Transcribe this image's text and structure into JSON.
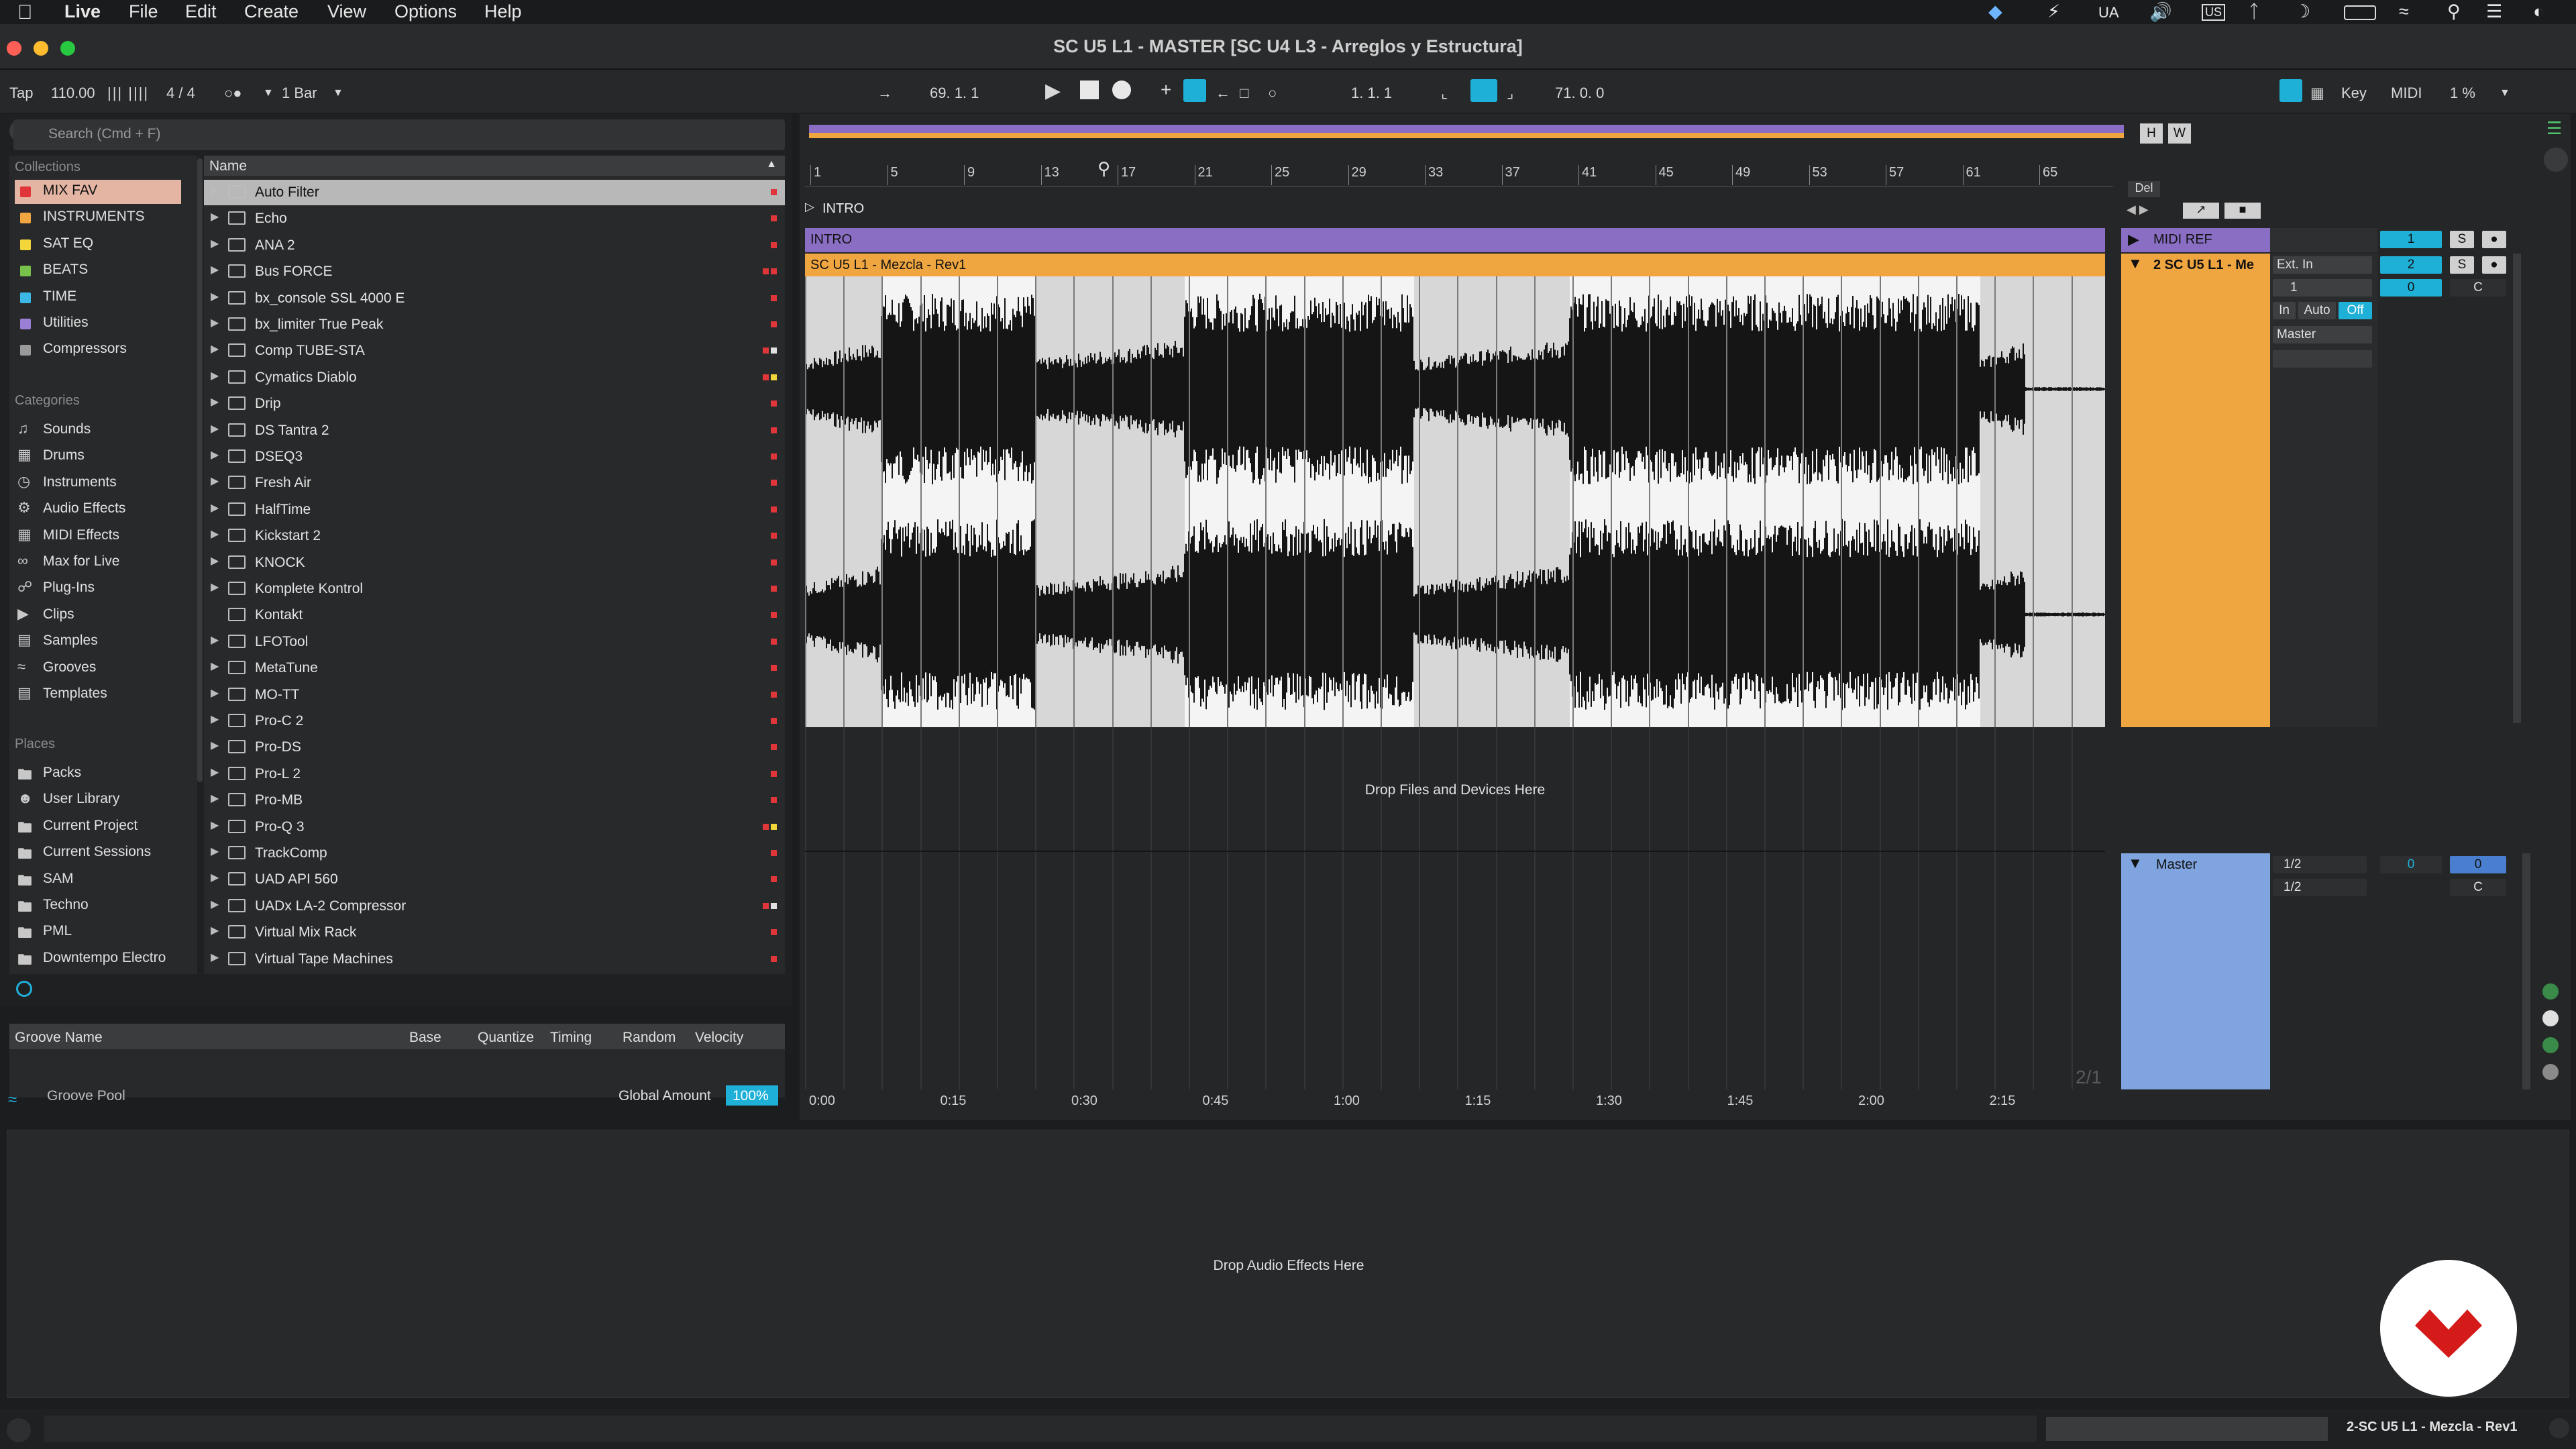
{
  "menubar": {
    "app": "Live",
    "items": [
      "File",
      "Edit",
      "Create",
      "View",
      "Options",
      "Help"
    ],
    "right": {
      "ua": "UA",
      "us": "US"
    }
  },
  "window": {
    "title": "SC U5 L1 - MASTER  [SC U4 L3 - Arreglos y Estructura]"
  },
  "transport": {
    "tap": "Tap",
    "tempo": "110.00",
    "signature": "4 / 4",
    "quantize": "1 Bar",
    "arrangement_position": "69.  1.  1",
    "loop_start": "1.  1.  1",
    "loop_length": "71.  0.  0",
    "key": "Key",
    "midi": "MIDI",
    "cpu": "1 %"
  },
  "browser": {
    "search_placeholder": "Search (Cmd + F)",
    "collections_label": "Collections",
    "collections": [
      {
        "label": "MIX FAV",
        "color": "#e0363a"
      },
      {
        "label": "INSTRUMENTS",
        "color": "#f0a640"
      },
      {
        "label": "SAT EQ",
        "color": "#f2d63a"
      },
      {
        "label": "BEATS",
        "color": "#76c24b"
      },
      {
        "label": "TIME",
        "color": "#3db8e6"
      },
      {
        "label": "Utilities",
        "color": "#9b7fd6"
      },
      {
        "label": "Compressors",
        "color": "#9a9a9a"
      }
    ],
    "categories_label": "Categories",
    "categories": [
      "Sounds",
      "Drums",
      "Instruments",
      "Audio Effects",
      "MIDI Effects",
      "Max for Live",
      "Plug-Ins",
      "Clips",
      "Samples",
      "Grooves",
      "Templates"
    ],
    "places_label": "Places",
    "places": [
      "Packs",
      "User Library",
      "Current Project",
      "Current Sessions",
      "SAM",
      "Techno",
      "PML",
      "Downtempo Electro"
    ],
    "name_header": "Name",
    "items": [
      {
        "label": "Auto Filter",
        "tags": [
          "#e0363a"
        ]
      },
      {
        "label": "Echo",
        "tags": [
          "#e0363a"
        ]
      },
      {
        "label": "ANA 2",
        "tags": [
          "#e0363a"
        ]
      },
      {
        "label": "Bus FORCE",
        "tags": [
          "#e0363a",
          "#e0363a"
        ]
      },
      {
        "label": "bx_console SSL 4000 E",
        "tags": [
          "#e0363a"
        ]
      },
      {
        "label": "bx_limiter True Peak",
        "tags": [
          "#e0363a"
        ]
      },
      {
        "label": "Comp TUBE-STA",
        "tags": [
          "#e0363a",
          "#e0e0e0"
        ]
      },
      {
        "label": "Cymatics Diablo",
        "tags": [
          "#e0363a",
          "#f2d63a"
        ]
      },
      {
        "label": "Drip",
        "tags": [
          "#e0363a"
        ]
      },
      {
        "label": "DS Tantra 2",
        "tags": [
          "#e0363a"
        ]
      },
      {
        "label": "DSEQ3",
        "tags": [
          "#e0363a"
        ]
      },
      {
        "label": "Fresh Air",
        "tags": [
          "#e0363a"
        ]
      },
      {
        "label": "HalfTime",
        "tags": [
          "#e0363a"
        ]
      },
      {
        "label": "Kickstart 2",
        "tags": [
          "#e0363a"
        ]
      },
      {
        "label": "KNOCK",
        "tags": [
          "#e0363a"
        ]
      },
      {
        "label": "Komplete Kontrol",
        "tags": [
          "#e0363a"
        ]
      },
      {
        "label": "Kontakt",
        "tags": [
          "#e0363a"
        ]
      },
      {
        "label": "LFOTool",
        "tags": [
          "#e0363a"
        ]
      },
      {
        "label": "MetaTune",
        "tags": [
          "#e0363a"
        ]
      },
      {
        "label": "MO-TT",
        "tags": [
          "#e0363a"
        ]
      },
      {
        "label": "Pro-C 2",
        "tags": [
          "#e0363a"
        ]
      },
      {
        "label": "Pro-DS",
        "tags": [
          "#e0363a"
        ]
      },
      {
        "label": "Pro-L 2",
        "tags": [
          "#e0363a"
        ]
      },
      {
        "label": "Pro-MB",
        "tags": [
          "#e0363a"
        ]
      },
      {
        "label": "Pro-Q 3",
        "tags": [
          "#e0363a",
          "#f2d63a"
        ]
      },
      {
        "label": "TrackComp",
        "tags": [
          "#e0363a"
        ]
      },
      {
        "label": "UAD API 560",
        "tags": [
          "#e0363a"
        ]
      },
      {
        "label": "UADx LA-2 Compressor",
        "tags": [
          "#e0363a",
          "#e0e0e0"
        ]
      },
      {
        "label": "Virtual Mix Rack",
        "tags": [
          "#e0363a"
        ]
      },
      {
        "label": "Virtual Tape Machines",
        "tags": [
          "#e0363a"
        ]
      }
    ]
  },
  "groove": {
    "columns": [
      "Groove Name",
      "Base",
      "Quantize",
      "Timing",
      "Random",
      "Velocity"
    ],
    "pool_label": "Groove Pool",
    "global_amount_label": "Global Amount",
    "global_amount": "100%"
  },
  "arrangement": {
    "bar_numbers": [
      "1",
      "5",
      "9",
      "13",
      "17",
      "21",
      "25",
      "29",
      "33",
      "37",
      "41",
      "45",
      "49",
      "53",
      "57",
      "61",
      "65"
    ],
    "locator": "INTRO",
    "scene_label": "INTRO",
    "clip_name": "SC U5 L1 - Mezcla - Rev1",
    "drop_text": "Drop Files and Devices Here",
    "time_ticks": [
      "0:00",
      "0:15",
      "0:30",
      "0:45",
      "1:00",
      "1:15",
      "1:30",
      "1:45",
      "2:00",
      "2:15"
    ],
    "zoom_label": "2/1",
    "hw": [
      "H",
      "W"
    ],
    "del": "Del"
  },
  "mixer": {
    "midi_ref": "MIDI REF",
    "midi_ref_num": "1",
    "track2_name": "2 SC U5 L1 - Me",
    "track2_num": "2",
    "input": "Ext. In",
    "input_ch": "1",
    "monitor": [
      "In",
      "Auto",
      "Off"
    ],
    "output": "Master",
    "vol": "0",
    "pan": "C",
    "solo": "S",
    "master": "Master",
    "master_in": "1/2",
    "master_out": "1/2",
    "master_vol": "0",
    "master_pan": "C",
    "master_vol2": "0"
  },
  "device": {
    "drop_text": "Drop Audio Effects Here"
  },
  "status": {
    "selected_clip": "2-SC U5 L1 - Mezcla - Rev1"
  },
  "colors": {
    "accent": "#1fb0d8",
    "scene": "#8a6ec4",
    "clip": "#f0a640",
    "master": "#7fa4e0"
  }
}
